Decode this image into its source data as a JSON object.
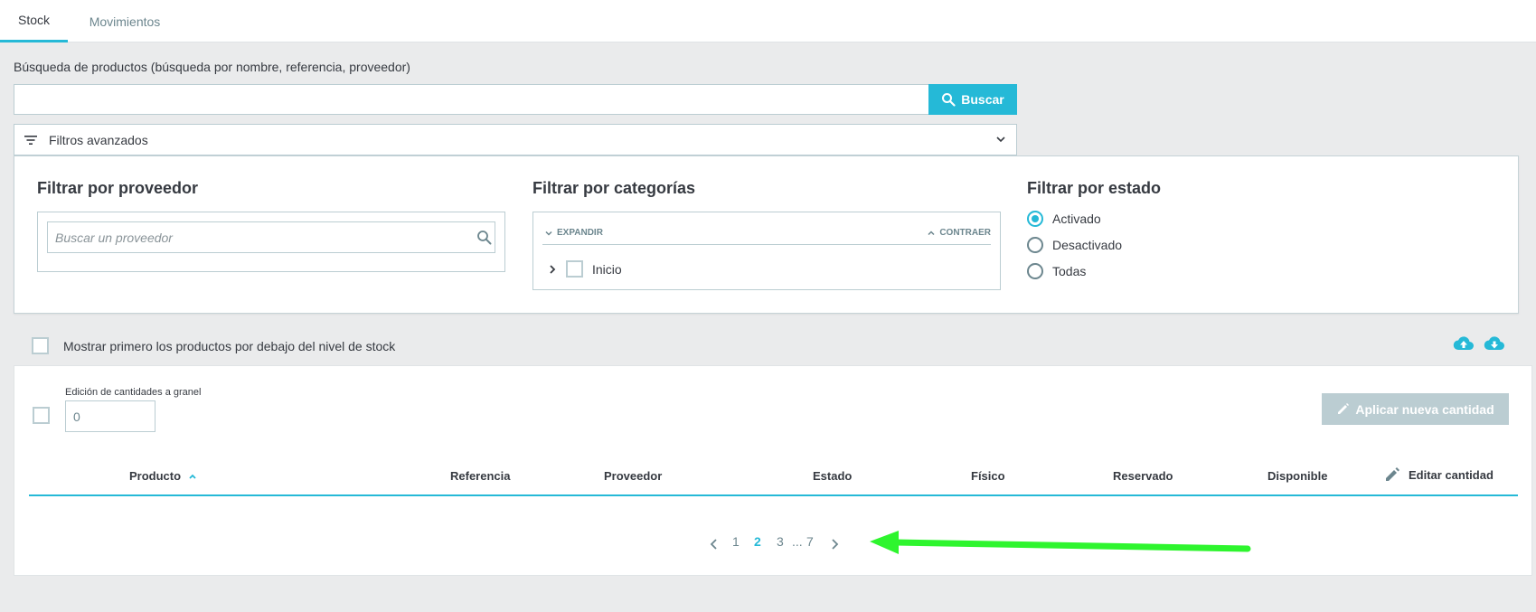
{
  "tabs": [
    {
      "label": "Stock",
      "active": true
    },
    {
      "label": "Movimientos",
      "active": false
    }
  ],
  "search": {
    "label": "Búsqueda de productos (búsqueda por nombre, referencia, proveedor)",
    "value": "",
    "button": "Buscar"
  },
  "advanced": {
    "label": "Filtros avanzados"
  },
  "filters": {
    "supplier": {
      "title": "Filtrar por proveedor",
      "placeholder": "Buscar un proveedor"
    },
    "categories": {
      "title": "Filtrar por categorías",
      "expand": "EXPANDIR",
      "collapse": "CONTRAER",
      "root": "Inicio"
    },
    "status": {
      "title": "Filtrar por estado",
      "options": [
        {
          "label": "Activado",
          "selected": true
        },
        {
          "label": "Desactivado",
          "selected": false
        },
        {
          "label": "Todas",
          "selected": false
        }
      ]
    }
  },
  "show_first_label": "Mostrar primero los productos por debajo del nivel de stock",
  "bulk": {
    "label": "Edición de cantidades a granel",
    "value": "0",
    "apply": "Aplicar nueva cantidad"
  },
  "table": {
    "columns": [
      "Producto",
      "Referencia",
      "Proveedor",
      "Estado",
      "Físico",
      "Reservado",
      "Disponible",
      "Editar cantidad"
    ]
  },
  "pagination": {
    "pages": [
      "1",
      "2",
      "3",
      "...",
      "7"
    ],
    "current": "2"
  },
  "colors": {
    "accent": "#25b9d7",
    "annotation_arrow": "#2ef52e"
  }
}
